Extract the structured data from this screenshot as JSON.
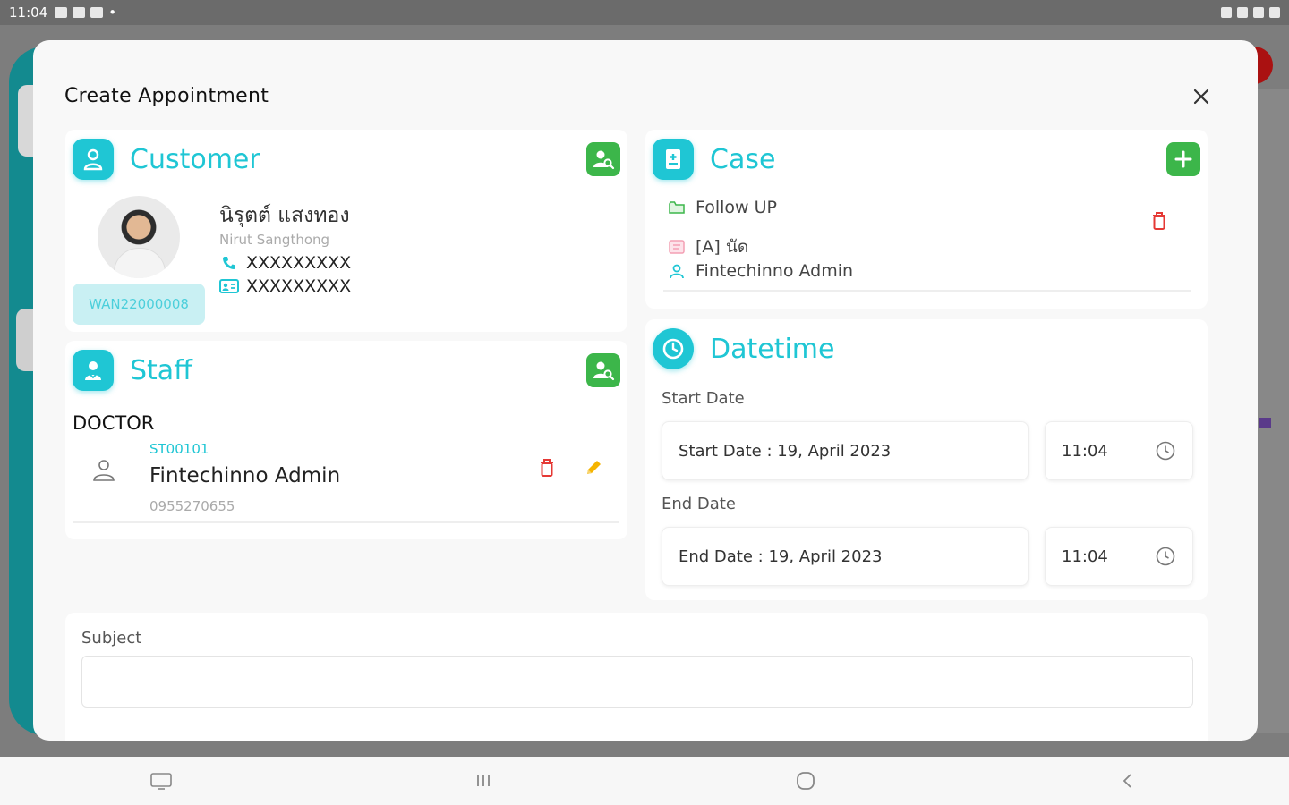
{
  "status_bar": {
    "time": "11:04"
  },
  "modal": {
    "title": "Create Appointment",
    "close_glyph": "✕"
  },
  "customer": {
    "title": "Customer",
    "name_th": "นิรุตต์ แสงทอง",
    "name_en": "Nirut Sangthong",
    "phone": "XXXXXXXXX",
    "id_card": "XXXXXXXXX",
    "code": "WAN22000008"
  },
  "staff": {
    "title": "Staff",
    "role": "DOCTOR",
    "code": "ST00101",
    "name": "Fintechinno Admin",
    "phone": "0955270655"
  },
  "case": {
    "title": "Case",
    "type": "Follow UP",
    "category": "[A] นัด",
    "owner": "Fintechinno Admin"
  },
  "datetime": {
    "title": "Datetime",
    "start_label": "Start Date",
    "start_value": "Start Date : 19, April 2023",
    "start_time": "11:04",
    "end_label": "End Date",
    "end_value": "End Date : 19, April 2023",
    "end_time": "11:04"
  },
  "subject": {
    "label": "Subject",
    "value": ""
  },
  "colors": {
    "accent": "#1fc6d4",
    "green": "#3cb64a",
    "danger": "#e53935",
    "edit": "#f5b400"
  }
}
